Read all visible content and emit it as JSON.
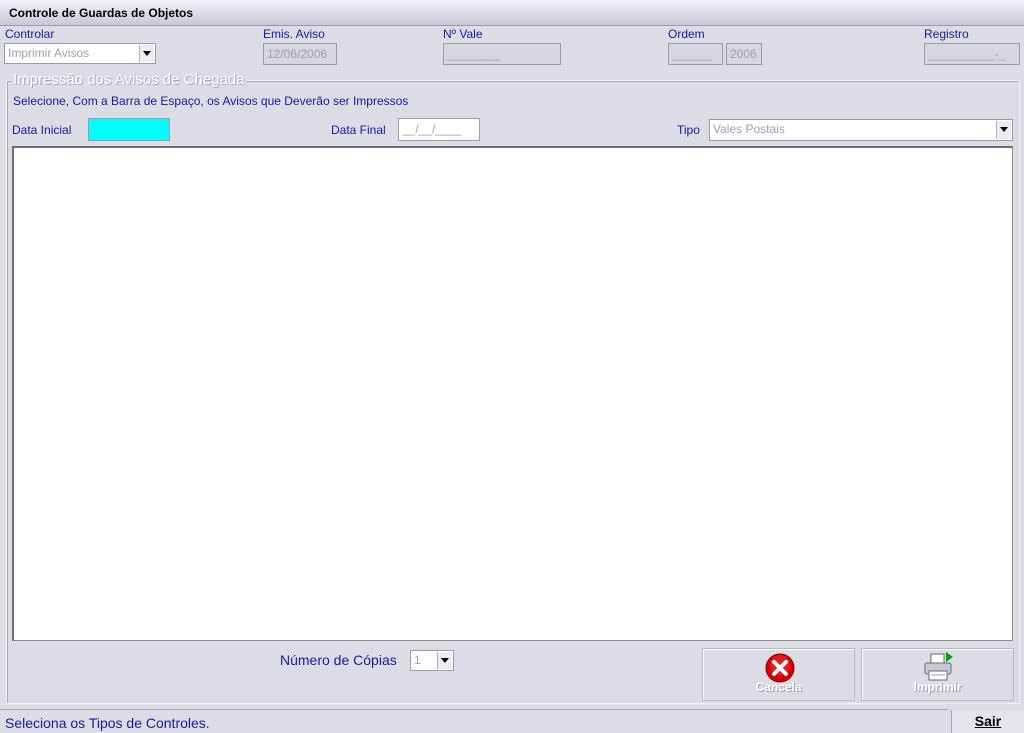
{
  "window": {
    "title": "Controle de Guardas de Objetos"
  },
  "header": {
    "controlar": {
      "label": "Controlar",
      "value": "Imprimir Avisos"
    },
    "emis_aviso": {
      "label": "Emis. Aviso",
      "value": "12/06/2006"
    },
    "n_vale": {
      "label": "Nº Vale",
      "value": "________"
    },
    "ordem": {
      "label": "Ordem",
      "value": "______",
      "year": "2006"
    },
    "registro": {
      "label": "Registro",
      "value": "__________-_"
    }
  },
  "group": {
    "title": "Impressão dos Avisos de Chegada",
    "instruction": "Selecione, Com a Barra de Espaço, os Avisos que Deverão ser Impressos",
    "data_inicial": {
      "label": "Data Inicial",
      "value": ""
    },
    "data_final": {
      "label": "Data Final",
      "value": "__/__/____"
    },
    "tipo": {
      "label": "Tipo",
      "value": "Vales Postais"
    },
    "copias": {
      "label": "Número de Cópias",
      "value": "1"
    }
  },
  "buttons": {
    "cancela": "Cancela",
    "imprimir": "Imprimir",
    "sair": "Sair"
  },
  "status": {
    "text": "Seleciona os Tipos de Controles."
  },
  "colors": {
    "label_blue": "#1a1aa0",
    "highlight_cyan": "#00ffff",
    "background": "#dcdce4"
  },
  "icons": {
    "cancel": "red-x-circle-icon",
    "print": "printer-icon"
  }
}
